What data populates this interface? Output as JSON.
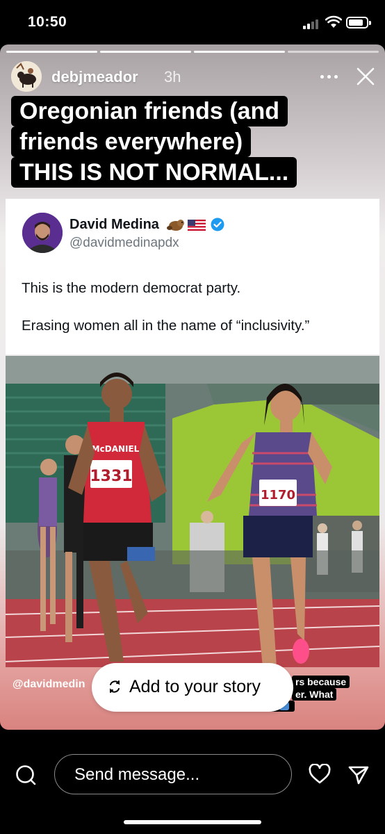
{
  "status_bar": {
    "time": "10:50"
  },
  "story": {
    "segments_total": 4,
    "username": "debjmeador",
    "time_ago": "3h",
    "caption_lines": [
      "Oregonian friends (and",
      "friends everywhere)",
      "THIS IS NOT NORMAL..."
    ],
    "tweet": {
      "name": "David Medina",
      "emoji": [
        "beaver-emoji",
        "us-flag-emoji"
      ],
      "verified": true,
      "handle": "@davidmedinapdx",
      "paragraphs": [
        "This is the modern democrat party.",
        "Erasing women all in the name of “inclusivity.”"
      ]
    },
    "photo": {
      "bib_left": "1331",
      "bib_right": "1170",
      "jersey_left": "McDANIEL"
    },
    "handle_tag": "@davidmedin",
    "overlay_snippets": [
      "rs because",
      "er. What"
    ],
    "add_to_story_label": "Add to your story"
  },
  "bottom_bar": {
    "message_placeholder": "Send message..."
  },
  "colors": {
    "accent_verified": "#1d9bf0",
    "jersey_red": "#d1283a",
    "track": "#b9434a"
  }
}
